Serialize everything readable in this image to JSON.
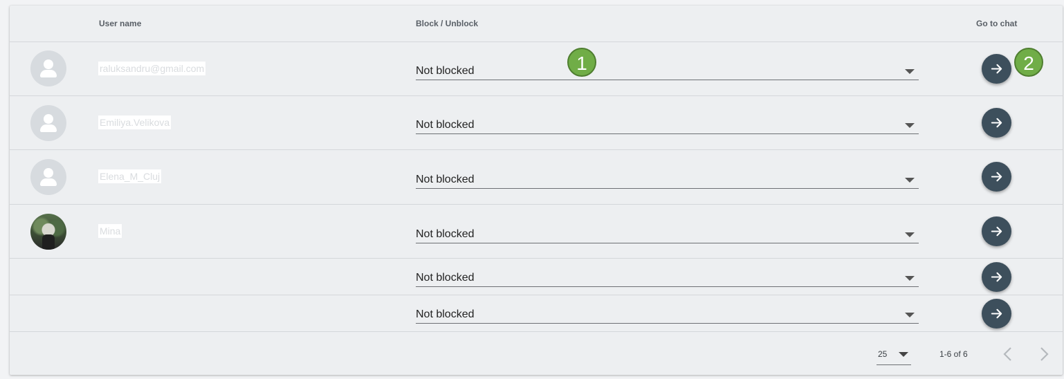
{
  "table": {
    "headers": {
      "user_name": "User name",
      "block_unblock": "Block / Unblock",
      "go_to_chat": "Go to chat"
    },
    "rows": [
      {
        "username": "raluksandru@gmail.com",
        "avatar": "default-avatar",
        "status": "Not blocked"
      },
      {
        "username": "Emiliya.Velikova",
        "avatar": "default-avatar",
        "status": "Not blocked"
      },
      {
        "username": "Elena_M_Cluj",
        "avatar": "default-avatar",
        "status": "Not blocked"
      },
      {
        "username": "Mina",
        "avatar": "photo-avatar",
        "status": "Not blocked"
      },
      {
        "username": "",
        "avatar": "",
        "status": "Not blocked"
      },
      {
        "username": "",
        "avatar": "",
        "status": "Not blocked"
      }
    ]
  },
  "pagination": {
    "page_size": "25",
    "range_label": "1-6 of 6"
  },
  "annotations": {
    "badge_1": "1",
    "badge_2": "2"
  },
  "colors": {
    "chat_button": "#3d4f5c",
    "annotation_badge": "#70ad47",
    "card_background": "#edeff1"
  },
  "icons": {
    "go_to_chat": "arrow-right-icon",
    "prev_page": "chevron-left-icon",
    "next_page": "chevron-right-icon",
    "dropdown": "caret-down-icon"
  }
}
